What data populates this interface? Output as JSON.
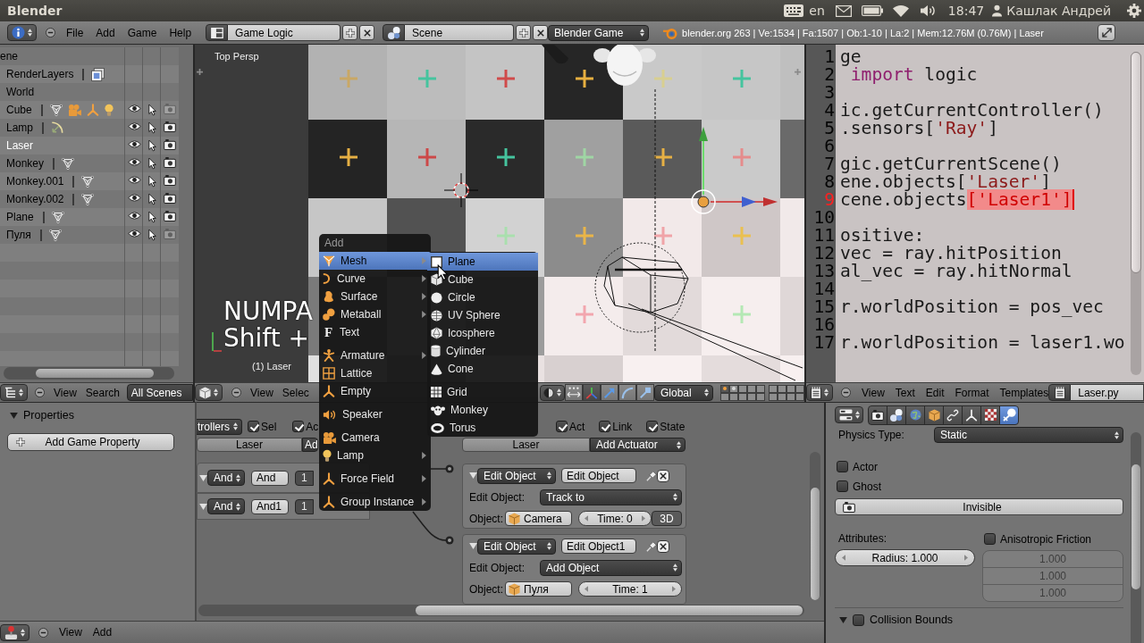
{
  "top_bar": {
    "title": "Blender",
    "keyboard_layout": "en",
    "clock": "18:47",
    "user": "Кашлак Андрей"
  },
  "info_header": {
    "menus": [
      "File",
      "Add",
      "Game",
      "Help"
    ],
    "screen": "Game Logic",
    "scene": "Scene",
    "engine": "Blender Game",
    "stats": "blender.org 263 | Ve:1534 | Fa:1507 | Ob:1-10 | La:2 | Mem:12.76M (0.76M) | Laser"
  },
  "outliner": {
    "rows": [
      {
        "name": "ene",
        "kind": "scene",
        "selected": false
      },
      {
        "name": "RenderLayers",
        "kind": "render_layers",
        "selected": false,
        "data": [
          {
            "kind": "render_layer"
          }
        ]
      },
      {
        "name": "World",
        "kind": "world",
        "selected": false
      },
      {
        "name": "Cube",
        "kind": "object",
        "selected": false,
        "renderable": false,
        "data": [
          {
            "kind": "mesh"
          },
          {
            "kind": "movie_camera"
          },
          {
            "kind": "axes"
          },
          {
            "kind": "bulb"
          }
        ]
      },
      {
        "name": "Lamp",
        "kind": "object",
        "selected": false,
        "renderable": true,
        "data": [
          {
            "kind": "spot_lamp"
          }
        ]
      },
      {
        "name": "Laser",
        "kind": "object",
        "selected": true,
        "renderable": true
      },
      {
        "name": "Monkey",
        "kind": "object",
        "selected": false,
        "renderable": true,
        "data": [
          {
            "kind": "mesh"
          }
        ]
      },
      {
        "name": "Monkey.001",
        "kind": "object",
        "selected": false,
        "renderable": true,
        "data": [
          {
            "kind": "mesh"
          }
        ]
      },
      {
        "name": "Monkey.002",
        "kind": "object",
        "selected": false,
        "renderable": true,
        "data": [
          {
            "kind": "mesh"
          }
        ]
      },
      {
        "name": "Plane",
        "kind": "object",
        "selected": false,
        "renderable": true,
        "data": [
          {
            "kind": "mesh"
          }
        ]
      },
      {
        "name": "Пуля",
        "kind": "object",
        "selected": false,
        "renderable": false,
        "data": [
          {
            "kind": "mesh"
          }
        ]
      }
    ],
    "header": {
      "menus": [
        "View",
        "Search"
      ],
      "filter": "All Scenes"
    }
  },
  "viewport": {
    "view_name": "Top Persp",
    "object_info": "(1) Laser",
    "key_overlay": [
      "NUMPA",
      "Shift +"
    ],
    "header": {
      "menus": [
        "View",
        "Selec"
      ],
      "orientation": "Global",
      "layer_blocks": [
        {
          "layers": [
            {
              "selected": true,
              "used": true
            },
            {
              "selected": false,
              "used": true
            },
            {
              "selected": false,
              "used": false
            },
            {
              "selected": false,
              "used": false
            },
            {
              "selected": false,
              "used": false
            },
            {
              "selected": false,
              "used": false
            },
            {
              "selected": false,
              "used": false
            },
            {
              "selected": false,
              "used": false
            },
            {
              "selected": false,
              "used": false
            },
            {
              "selected": false,
              "used": false
            }
          ]
        },
        {
          "layers": [
            {
              "selected": false,
              "used": false
            },
            {
              "selected": false,
              "used": false
            },
            {
              "selected": false,
              "used": false
            },
            {
              "selected": false,
              "used": false
            },
            {
              "selected": false,
              "used": false
            },
            {
              "selected": false,
              "used": false
            },
            {
              "selected": false,
              "used": false
            },
            {
              "selected": false,
              "used": false
            }
          ]
        }
      ]
    }
  },
  "text_editor": {
    "lines": [
      {
        "number": "1",
        "current": false,
        "segments": [
          {
            "text": "ge",
            "kind": "plain"
          }
        ]
      },
      {
        "number": "2",
        "current": false,
        "segments": [
          {
            "text": " import",
            "kind": "keyword"
          },
          {
            "text": " logic",
            "kind": "plain"
          }
        ]
      },
      {
        "number": "3",
        "current": false
      },
      {
        "number": "4",
        "current": false,
        "segments": [
          {
            "text": "ic.getCurrentController()",
            "kind": "plain"
          }
        ]
      },
      {
        "number": "5",
        "current": false,
        "segments": [
          {
            "text": ".sensors[",
            "kind": "plain"
          },
          {
            "text": "'Ray'",
            "kind": "string"
          },
          {
            "text": "]",
            "kind": "plain"
          }
        ]
      },
      {
        "number": "6",
        "current": false
      },
      {
        "number": "7",
        "current": false,
        "segments": [
          {
            "text": "gic.getCurrentScene()",
            "kind": "plain"
          }
        ]
      },
      {
        "number": "8",
        "current": false,
        "segments": [
          {
            "text": "ene.objects[",
            "kind": "plain"
          },
          {
            "text": "'Laser'",
            "kind": "string"
          },
          {
            "text": "]",
            "kind": "plain"
          }
        ]
      },
      {
        "number": "9",
        "current": true,
        "segments": [
          {
            "text": "cene.objects",
            "kind": "plain"
          },
          {
            "text": "['Laser1']",
            "kind": "highlight"
          }
        ]
      },
      {
        "number": "10",
        "current": false
      },
      {
        "number": "11",
        "current": false,
        "segments": [
          {
            "text": "ositive:",
            "kind": "plain"
          }
        ]
      },
      {
        "number": "12",
        "current": false,
        "segments": [
          {
            "text": "vec = ray.hitPosition",
            "kind": "plain"
          }
        ]
      },
      {
        "number": "13",
        "current": false,
        "segments": [
          {
            "text": "al_vec = ray.hitNormal",
            "kind": "plain"
          }
        ]
      },
      {
        "number": "14",
        "current": false
      },
      {
        "number": "15",
        "current": false,
        "segments": [
          {
            "text": "r.worldPosition = pos_vec",
            "kind": "plain"
          }
        ]
      },
      {
        "number": "16",
        "current": false
      },
      {
        "number": "17",
        "current": false,
        "segments": [
          {
            "text": "r.worldPosition = laser1.wo",
            "kind": "plain"
          }
        ]
      }
    ],
    "header": {
      "menus": [
        "View",
        "Text",
        "Edit",
        "Format",
        "Templates"
      ],
      "file": "Laser.py"
    }
  },
  "logic_sidebar": {
    "title": "Properties",
    "expanded": true,
    "button": "Add Game Property"
  },
  "logic_editor": {
    "controllers": {
      "type_menu": "trollers",
      "filters": [
        {
          "label": "Sel",
          "checked": true
        },
        {
          "label": "Ac",
          "checked": true
        }
      ],
      "object": "Laser",
      "add_menu": "Ad",
      "items": [
        {
          "type": "And",
          "name": "And",
          "state": "1",
          "expanded": true
        },
        {
          "type": "And",
          "name": "And1",
          "state": "1",
          "expanded": true
        }
      ]
    },
    "actuators": {
      "filters": [
        {
          "label": "Act",
          "checked": true
        },
        {
          "label": "Link",
          "checked": true
        },
        {
          "label": "State",
          "checked": true
        }
      ],
      "object": "Laser",
      "add_menu": "Add Actuator",
      "items": [
        {
          "type": "Edit Object",
          "name": "Edit Object",
          "expanded": true,
          "mode_label": "Edit Object:",
          "mode": "Track to",
          "object_label": "Object:",
          "object": "Camera",
          "time": "Time: 0",
          "toggle": "3D"
        },
        {
          "type": "Edit Object",
          "name": "Edit Object1",
          "expanded": true,
          "mode_label": "Edit Object:",
          "mode": "Add Object",
          "object_label": "Object:",
          "object": "Пуля",
          "time": "Time: 1"
        }
      ]
    }
  },
  "logic_footer": {
    "menus": [
      "View",
      "Add"
    ]
  },
  "properties": {
    "tabs": [
      {
        "kind": "render",
        "selected": false
      },
      {
        "kind": "scene",
        "selected": false
      },
      {
        "kind": "world",
        "selected": false
      },
      {
        "kind": "object",
        "selected": false
      },
      {
        "kind": "constraints",
        "selected": false
      },
      {
        "kind": "data",
        "selected": false
      },
      {
        "kind": "texture",
        "selected": false
      },
      {
        "kind": "physics",
        "selected": true
      }
    ],
    "physics_type_label": "Physics Type:",
    "physics_type": "Static",
    "flags": [
      {
        "label": "Actor",
        "checked": false
      },
      {
        "label": "Ghost",
        "checked": false
      }
    ],
    "invisible": {
      "label": "Invisible",
      "on": false
    },
    "attributes_label": "Attributes:",
    "radius": "Radius: 1.000",
    "anisotropic": {
      "label": "Anisotropic Friction",
      "checked": false,
      "values": [
        "1.000",
        "1.000",
        "1.000"
      ]
    },
    "collision_bounds": {
      "label": "Collision Bounds",
      "checked": false,
      "expanded": true
    }
  },
  "add_menu": {
    "title": "Add",
    "sections": [
      {
        "items": [
          {
            "label": "Mesh",
            "kind": "mesh",
            "selected": true,
            "submenu": true
          },
          {
            "label": "Curve",
            "kind": "curve",
            "selected": false,
            "submenu": true
          },
          {
            "label": "Surface",
            "kind": "surface",
            "selected": false,
            "submenu": true
          },
          {
            "label": "Metaball",
            "kind": "metaball",
            "selected": false,
            "submenu": true
          },
          {
            "label": "Text",
            "kind": "glyph",
            "glyph": "F",
            "selected": false,
            "submenu": false
          }
        ]
      },
      {
        "items": [
          {
            "label": "Armature",
            "kind": "armature",
            "selected": false,
            "submenu": true
          },
          {
            "label": "Lattice",
            "kind": "lattice",
            "selected": false,
            "submenu": false
          },
          {
            "label": "Empty",
            "kind": "empty",
            "selected": false,
            "submenu": false
          }
        ]
      },
      {
        "items": [
          {
            "label": "Speaker",
            "kind": "speaker",
            "selected": false,
            "submenu": false
          }
        ]
      },
      {
        "items": [
          {
            "label": "Camera",
            "kind": "camera",
            "selected": false,
            "submenu": false
          },
          {
            "label": "Lamp",
            "kind": "lamp",
            "selected": false,
            "submenu": true
          }
        ]
      },
      {
        "items": [
          {
            "label": "Force Field",
            "kind": "force_field",
            "selected": false,
            "submenu": true
          }
        ]
      },
      {
        "items": [
          {
            "label": "Group Instance",
            "kind": "group_instance",
            "selected": false,
            "submenu": true
          }
        ]
      }
    ],
    "submenu": {
      "sections": [
        {
          "items": [
            {
              "label": "Plane",
              "kind": "plane",
              "selected": true
            },
            {
              "label": "Cube",
              "kind": "cube",
              "selected": false
            },
            {
              "label": "Circle",
              "kind": "circle",
              "selected": false
            },
            {
              "label": "UV Sphere",
              "kind": "uv_sphere",
              "selected": false
            },
            {
              "label": "Icosphere",
              "kind": "icosphere",
              "selected": false
            },
            {
              "label": "Cylinder",
              "kind": "cylinder",
              "selected": false
            },
            {
              "label": "Cone",
              "kind": "cone",
              "selected": false
            }
          ]
        },
        {
          "items": [
            {
              "label": "Grid",
              "kind": "grid",
              "selected": false
            },
            {
              "label": "Monkey",
              "kind": "monkey",
              "selected": false
            },
            {
              "label": "Torus",
              "kind": "torus",
              "selected": false
            }
          ]
        }
      ]
    }
  }
}
